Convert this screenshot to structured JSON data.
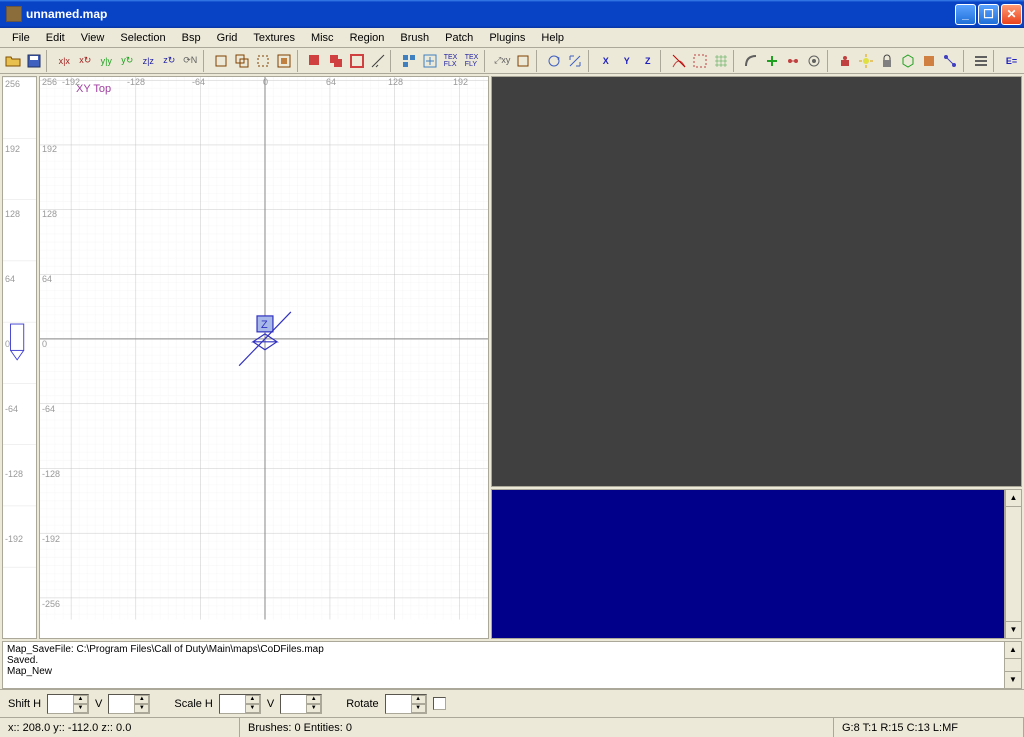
{
  "window": {
    "title": "unnamed.map"
  },
  "menu": [
    "File",
    "Edit",
    "View",
    "Selection",
    "Bsp",
    "Grid",
    "Textures",
    "Misc",
    "Region",
    "Brush",
    "Patch",
    "Plugins",
    "Help"
  ],
  "grid": {
    "view_label": "XY Top",
    "x_ticks": [
      "-192",
      "-128",
      "-64",
      "0",
      "64",
      "128",
      "192"
    ],
    "y_ticks": [
      "256",
      "192",
      "128",
      "64",
      "0",
      "-64",
      "-128",
      "-192",
      "-256"
    ]
  },
  "side_ruler_ticks": [
    "256",
    "192",
    "128",
    "64",
    "0",
    "-64",
    "-128",
    "-192"
  ],
  "console": {
    "line1": "Map_SaveFile: C:\\Program Files\\Call of Duty\\Main\\maps\\CoDFiles.map",
    "line2": "Saved.",
    "line3": "Map_New"
  },
  "controls": {
    "shift_h": "Shift H",
    "v1": "V",
    "scale_h": "Scale H",
    "v2": "V",
    "rotate": "Rotate"
  },
  "status": {
    "coords": "x:: 208.0  y:: -112.0  z:: 0.0",
    "brushes": "Brushes: 0 Entities: 0",
    "info": "G:8 T:1 R:15 C:13 L:MF"
  }
}
